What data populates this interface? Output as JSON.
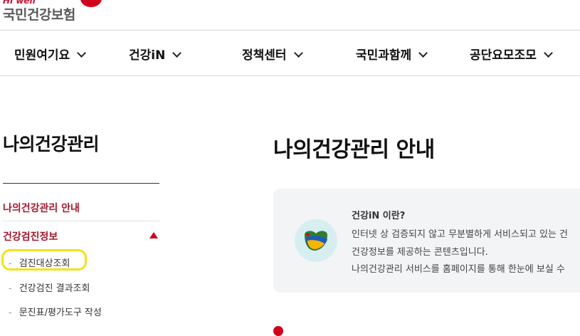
{
  "header": {
    "logo_tagline": "Hi well",
    "logo_text": "국민건강보험"
  },
  "gnb": {
    "items": [
      {
        "label": "민원여기요"
      },
      {
        "label": "건강iN"
      },
      {
        "label": "정책센터"
      },
      {
        "label": "국민과함께"
      },
      {
        "label": "공단요모조모"
      }
    ]
  },
  "sidebar": {
    "title": "나의건강관리",
    "menu": [
      {
        "label": "나의건강관리 안내",
        "active": true
      },
      {
        "label": "건강검진정보",
        "expanded": true
      }
    ],
    "submenu": [
      {
        "label": "검진대상조회",
        "highlighted": true
      },
      {
        "label": "건강검진 결과조회"
      },
      {
        "label": "문진표/평가도구 작성"
      }
    ],
    "dash": "-"
  },
  "main": {
    "title": "나의건강관리 안내",
    "info": {
      "heading": "건강iN 이란?",
      "lines": [
        "인터넷 상 검증되지 않고 무분별하게 서비스되고 있는 건",
        "건강정보를 제공하는 콘텐츠입니다.",
        "나의건강관리 서비스를 홈페이지를 통해 한눈에 보실 수"
      ]
    }
  },
  "colors": {
    "brand_red": "#d0021b",
    "active_text": "#a3172c",
    "highlight": "#f5e11b",
    "info_bg": "#f3f4f6"
  },
  "icons": {
    "logo": "nhis-logo-mark",
    "chevron": "chevron-down-icon",
    "collapse": "triangle-up-icon",
    "info": "health-in-logo-icon"
  }
}
